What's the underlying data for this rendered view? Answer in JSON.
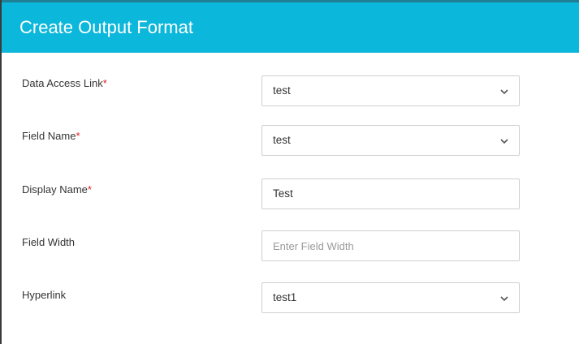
{
  "dialog": {
    "title": "Create Output Format"
  },
  "fields": {
    "data_access_link": {
      "label": "Data Access Link",
      "required_marker": "*",
      "value": "test",
      "icon": "chevron-down-icon"
    },
    "field_name": {
      "label": "Field Name",
      "required_marker": "*",
      "value": "test",
      "icon": "chevron-down-icon"
    },
    "display_name": {
      "label": "Display Name",
      "required_marker": "*",
      "value": "Test"
    },
    "field_width": {
      "label": "Field Width",
      "value": "",
      "placeholder": "Enter Field Width"
    },
    "hyperlink": {
      "label": "Hyperlink",
      "value": "test1",
      "icon": "chevron-down-icon"
    }
  },
  "colors": {
    "header_background": "#0bb7db",
    "header_text": "#ffffff",
    "required_marker": "#e02020",
    "input_border": "#cfcfcf"
  }
}
